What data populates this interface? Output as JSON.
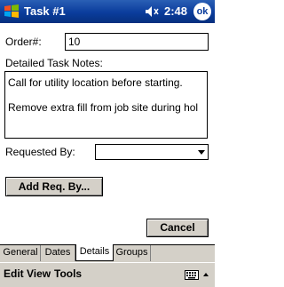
{
  "titlebar": {
    "title": "Task #1",
    "time": "2:48",
    "ok_label": "ok"
  },
  "form": {
    "order_label": "Order#:",
    "order_value": "10",
    "notes_label": "Detailed Task Notes:",
    "notes_lines": [
      "Call for utility location before starting.",
      "Remove extra fill from job site during hol"
    ],
    "requested_by_label": "Requested By:",
    "requested_by_value": "",
    "add_req_label": "Add Req. By...",
    "cancel_label": "Cancel"
  },
  "tabs": [
    {
      "label": "General"
    },
    {
      "label": "Dates"
    },
    {
      "label": "Details",
      "active": true
    },
    {
      "label": "Groups"
    }
  ],
  "menubar": {
    "items": [
      {
        "label": "Edit"
      },
      {
        "label": "View"
      },
      {
        "label": "Tools"
      }
    ]
  },
  "colors": {
    "titlebar": "#0a3c9c",
    "chrome": "#d4d0c8"
  }
}
